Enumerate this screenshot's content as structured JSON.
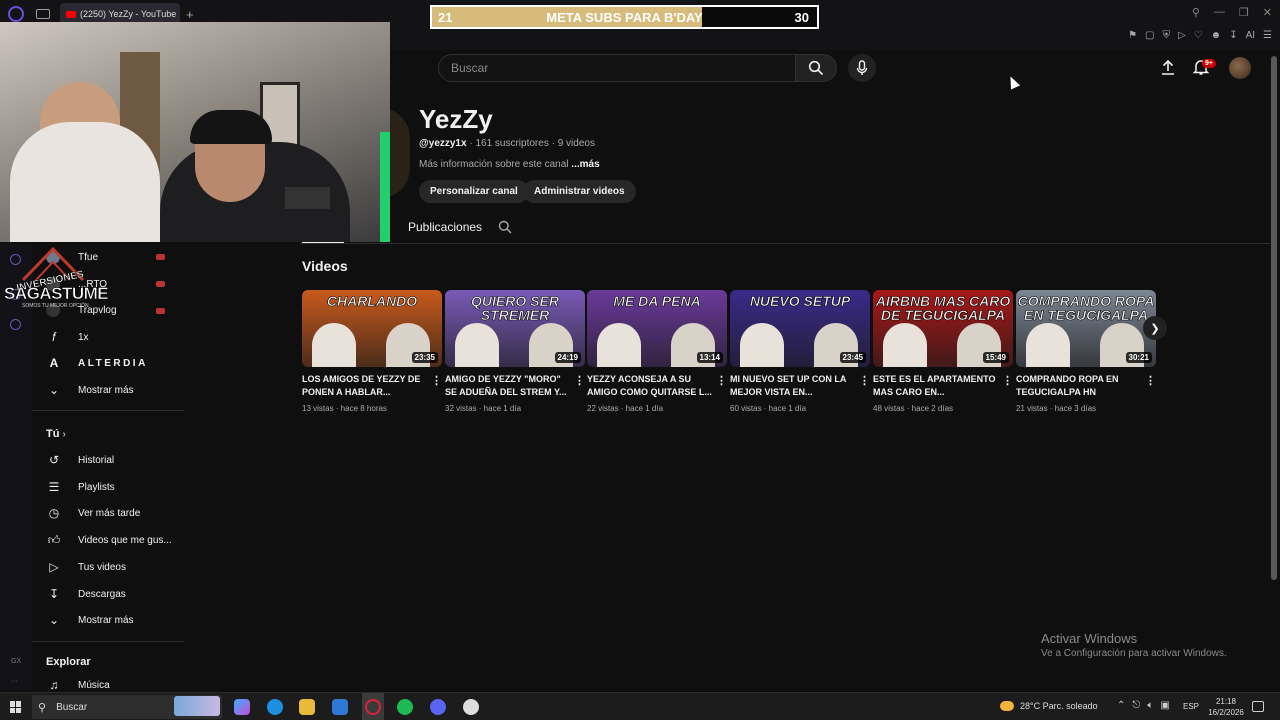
{
  "browser": {
    "tab_title": "(2250) YezZy - YouTube",
    "new_tab_glyph": "+",
    "toolbar_ai_label": "AI"
  },
  "goal_banner": {
    "current": "21",
    "title": "META SUBS PARA B'DAY",
    "target": "30",
    "progress_fraction": 0.7,
    "fill_color": "#d7bb7a"
  },
  "header": {
    "search_placeholder": "Buscar",
    "notification_badge": "9+"
  },
  "channel": {
    "name": "YezZy",
    "handle": "@yezzy1x",
    "stats": " · 161 suscriptores · 9 videos",
    "description": "Más información sobre este canal ",
    "more_label": "...más",
    "customize_button": "Personalizar canal",
    "manage_button": "Administrar videos",
    "tabs": [
      "Publicaciones"
    ]
  },
  "logo_overlay": {
    "line1": "INVERSIONES",
    "line2": "SAGASTUME",
    "line3": "SOMOS TU MEJOR OPCIÓN"
  },
  "sidebar": {
    "subscriptions": [
      {
        "label": "Tfue",
        "live": true
      },
      {
        "label": "...RTO",
        "live": true
      },
      {
        "label": "Trapvlog",
        "live": true
      },
      {
        "label": "1x",
        "live": false
      },
      {
        "label": "ALTERDIA",
        "live": false
      }
    ],
    "show_more_1": "Mostrar más",
    "you_heading": "Tú",
    "you_items": [
      {
        "label": "Historial",
        "icon": "history-icon"
      },
      {
        "label": "Playlists",
        "icon": "playlists-icon"
      },
      {
        "label": "Ver más tarde",
        "icon": "watch-later-icon"
      },
      {
        "label": "Videos que me gus...",
        "icon": "liked-videos-icon"
      },
      {
        "label": "Tus videos",
        "icon": "your-videos-icon"
      },
      {
        "label": "Descargas",
        "icon": "downloads-icon"
      }
    ],
    "show_more_2": "Mostrar más",
    "explore_heading": "Explorar",
    "explore_items": [
      {
        "label": "Música",
        "icon": "music-icon"
      }
    ],
    "rail_label": "GX"
  },
  "videos_section": {
    "title": "Videos",
    "videos": [
      {
        "thumb_text": "CHARLANDO",
        "duration": "23:35",
        "title": "LOS AMIGOS DE YEZZY DE PONEN A HABLAR...",
        "meta": "13 vistas · hace 8 horas",
        "bg": "#c95a1c"
      },
      {
        "thumb_text": "QUIERO SER STREMER",
        "duration": "24:19",
        "title": "AMIGO DE YEZZY \"MORO\" SE ADUEÑA DEL STREM Y...",
        "meta": "32 vistas · hace 1 día",
        "bg": "#7a5ab8"
      },
      {
        "thumb_text": "ME DA PENA",
        "duration": "13:14",
        "title": "YEZZY ACONSEJA A SU AMIGO COMO QUITARSE L...",
        "meta": "22 vistas · hace 1 día",
        "bg": "#6a3a9a"
      },
      {
        "thumb_text": "NUEVO SETUP",
        "duration": "23:45",
        "title": "MI NUEVO SET UP CON LA MEJOR VISTA EN...",
        "meta": "60 vistas · hace 1 día",
        "bg": "#3a2a8a"
      },
      {
        "thumb_text": "AIRBNB MAS CARO DE TEGUCIGALPA",
        "duration": "15:49",
        "title": "ESTE ES EL APARTAMENTO MAS CARO EN...",
        "meta": "48 vistas · hace 2 días",
        "bg": "#a81818"
      },
      {
        "thumb_text": "COMPRANDO ROPA EN TEGUCIGALPA",
        "duration": "30:21",
        "title": "COMPRANDO ROPA EN TEGUCIGALPA HN",
        "meta": "21 vistas · hace 3 días",
        "bg": "#7c8694"
      }
    ]
  },
  "watermark": {
    "title": "Activar Windows",
    "subtitle": "Ve a Configuración para activar Windows."
  },
  "taskbar": {
    "search_label": "Buscar",
    "weather": "28°C  Parc. soleado",
    "language": "ESP",
    "time": "21:18",
    "date": "16/2/2026"
  }
}
